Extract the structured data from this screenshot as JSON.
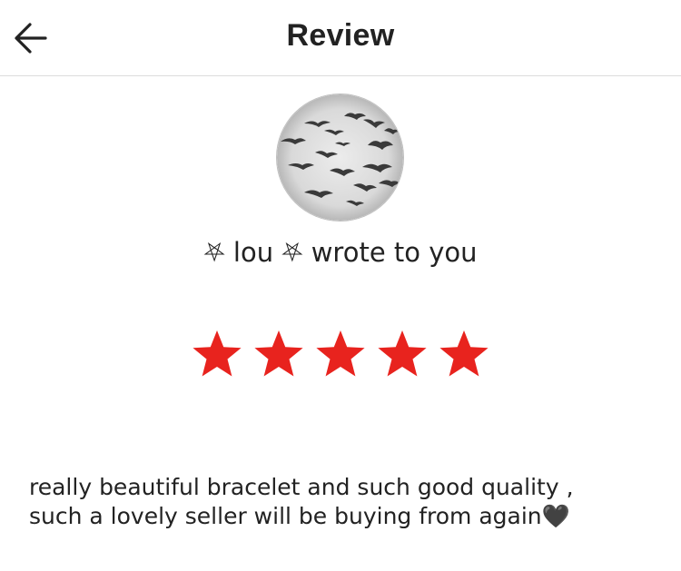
{
  "header": {
    "title": "Review",
    "back_icon": "arrow-left-icon"
  },
  "reviewer": {
    "avatar_icon": "bat-avatar-image",
    "wrote_line": "⛧ lou ⛧ wrote to you"
  },
  "rating": {
    "value": 5,
    "max": 5,
    "star_color": "#e8231e"
  },
  "review": {
    "line1": "really beautiful bracelet and such good quality ,",
    "line2": "such a lovely seller will be buying from again🖤"
  }
}
